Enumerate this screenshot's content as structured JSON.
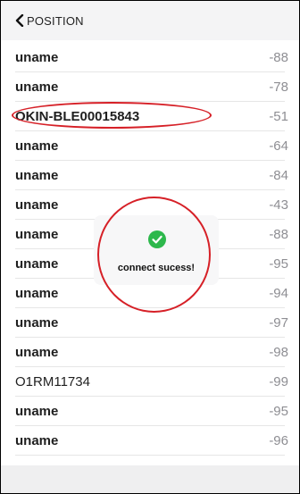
{
  "nav": {
    "back_label": "POSITION"
  },
  "devices": [
    {
      "name": "uname",
      "rssi": "-88"
    },
    {
      "name": "uname",
      "rssi": "-78"
    },
    {
      "name": "OKIN-BLE00015843",
      "rssi": "-51"
    },
    {
      "name": "uname",
      "rssi": "-64"
    },
    {
      "name": "uname",
      "rssi": "-84"
    },
    {
      "name": "uname",
      "rssi": "-43"
    },
    {
      "name": "uname",
      "rssi": "-88"
    },
    {
      "name": "uname",
      "rssi": "-95"
    },
    {
      "name": "uname",
      "rssi": "-94"
    },
    {
      "name": "uname",
      "rssi": "-97"
    },
    {
      "name": "uname",
      "rssi": "-98"
    },
    {
      "name": "O1RM11734",
      "rssi": "-99"
    },
    {
      "name": "uname",
      "rssi": "-95"
    },
    {
      "name": "uname",
      "rssi": "-96"
    }
  ],
  "toast": {
    "message": "connect sucess!",
    "icon": "check-circle-icon",
    "icon_color": "#2db84c"
  },
  "colors": {
    "annotation": "#d62027",
    "rssi_text": "#8e8e93"
  }
}
